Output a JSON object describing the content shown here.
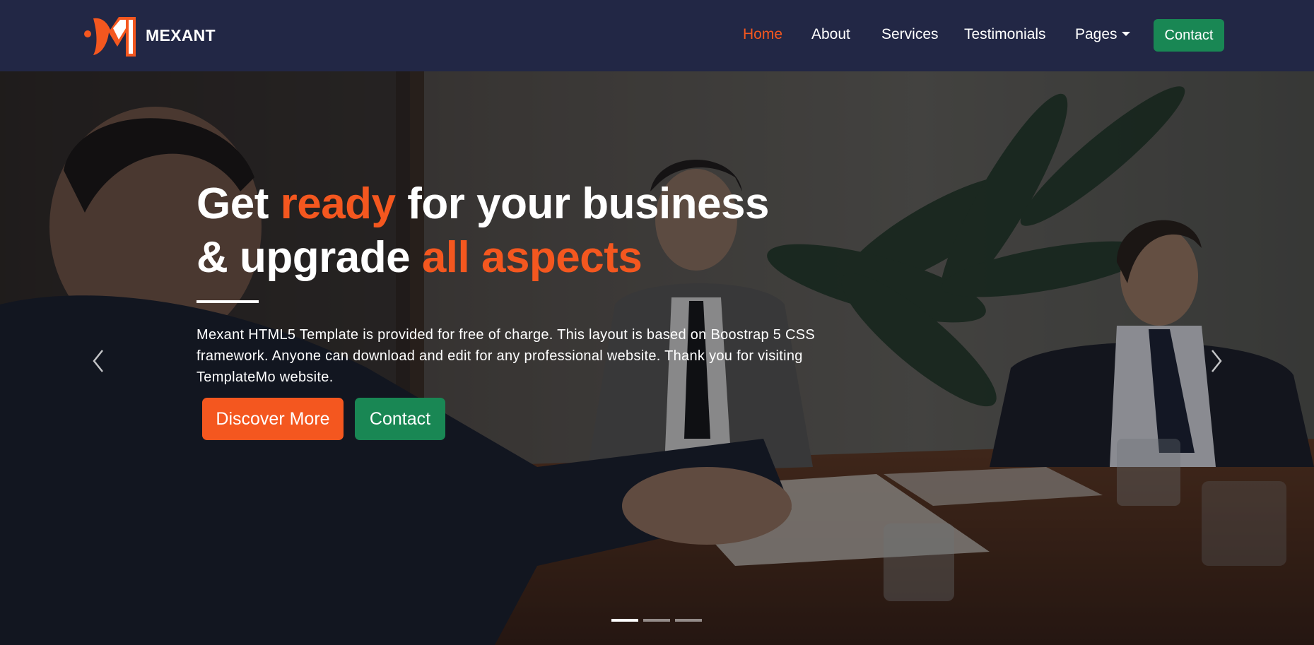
{
  "brand": {
    "name": "MEXANT",
    "logo_icon": "mexant-fish-logo-icon"
  },
  "nav": {
    "items": [
      {
        "label": "Home",
        "active": true
      },
      {
        "label": "About",
        "active": false
      },
      {
        "label": "Services",
        "active": false
      },
      {
        "label": "Testimonials",
        "active": false
      },
      {
        "label": "Pages",
        "active": false,
        "dropdown": true
      }
    ],
    "contact_label": "Contact"
  },
  "hero": {
    "headline": {
      "part1": "Get ",
      "highlight1": "ready",
      "part2": " for your business",
      "part3": "& upgrade ",
      "highlight2": "all aspects"
    },
    "description": "Mexant HTML5 Template is provided for free of charge. This layout is based on Boostrap 5 CSS framework. Anyone can download and edit for any professional website. Thank you for visiting TemplateMo website.",
    "primary_button": "Discover More",
    "secondary_button": "Contact",
    "prev_icon": "chevron-left-icon",
    "next_icon": "chevron-right-icon",
    "slides_total": 3,
    "active_slide": 1
  },
  "colors": {
    "navbar_bg": "#222745",
    "accent_orange": "#f4571f",
    "accent_green": "#198754",
    "text_light": "#ffffff"
  }
}
